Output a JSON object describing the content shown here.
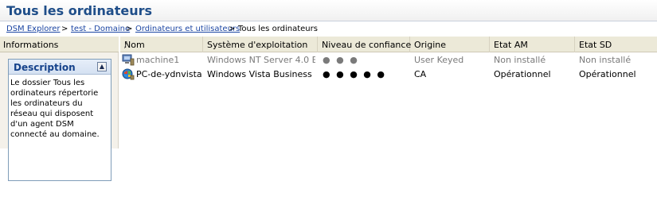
{
  "header": {
    "title": "Tous les ordinateurs"
  },
  "breadcrumb": {
    "items": [
      "DSM Explorer",
      "test - Domaine",
      "Ordinateurs et utilisateurs",
      "Tous les ordinateurs"
    ],
    "separator": ">"
  },
  "left_panel": {
    "header": "Informations",
    "description": {
      "title": "Description",
      "collapse_icon": "collapse-icon",
      "text": "Le dossier Tous les ordinateurs répertorie les ordinateurs du réseau qui disposent d'un agent DSM connecté au domaine."
    }
  },
  "table": {
    "columns": [
      "Nom",
      "Système d'exploitation",
      "Niveau de confiance",
      "Origine",
      "Etat AM",
      "Etat SD"
    ],
    "sort_indicator": "/",
    "rows": [
      {
        "icon": "computer-icon",
        "name": "machine1",
        "os": "Windows NT Server 4.0 E...",
        "trust": "● ● ●",
        "origin": "User Keyed",
        "am": "Non installé",
        "sd": "Non installé"
      },
      {
        "icon": "vista-computer-icon",
        "name": "PC-de-ydnvista",
        "os": "Windows Vista Business",
        "trust": "● ● ● ● ●",
        "origin": "CA",
        "am": "Opérationnel",
        "sd": "Opérationnel"
      }
    ]
  }
}
